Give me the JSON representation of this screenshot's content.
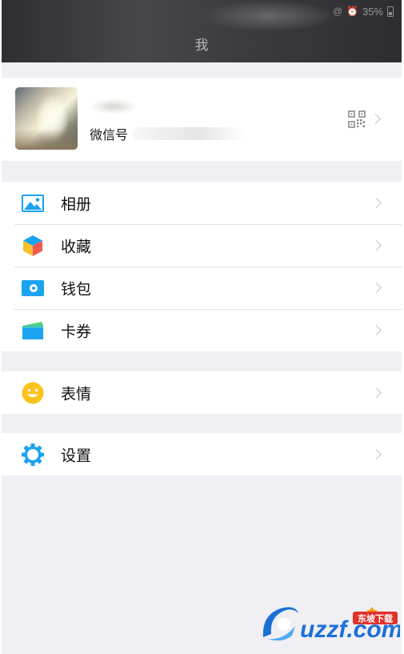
{
  "status_bar": {
    "battery": "35%"
  },
  "header": {
    "title": "我"
  },
  "profile": {
    "wechat_id_label": "微信号"
  },
  "groups": [
    {
      "items": [
        {
          "key": "album",
          "label": "相册",
          "icon": "album-icon"
        },
        {
          "key": "favorites",
          "label": "收藏",
          "icon": "favorites-icon"
        },
        {
          "key": "wallet",
          "label": "钱包",
          "icon": "wallet-icon"
        },
        {
          "key": "cards",
          "label": "卡券",
          "icon": "cards-icon"
        }
      ]
    },
    {
      "items": [
        {
          "key": "stickers",
          "label": "表情",
          "icon": "smiley-icon"
        }
      ]
    },
    {
      "items": [
        {
          "key": "settings",
          "label": "设置",
          "icon": "settings-gear-icon"
        }
      ]
    }
  ],
  "watermark": {
    "text": "uzzf.com",
    "tag": "东坡下载"
  },
  "colors": {
    "accent_blue": "#1aa3f0",
    "smiley_yellow": "#fbc21b",
    "header_dark": "#3a3a3e",
    "page_bg": "#efeff4"
  }
}
